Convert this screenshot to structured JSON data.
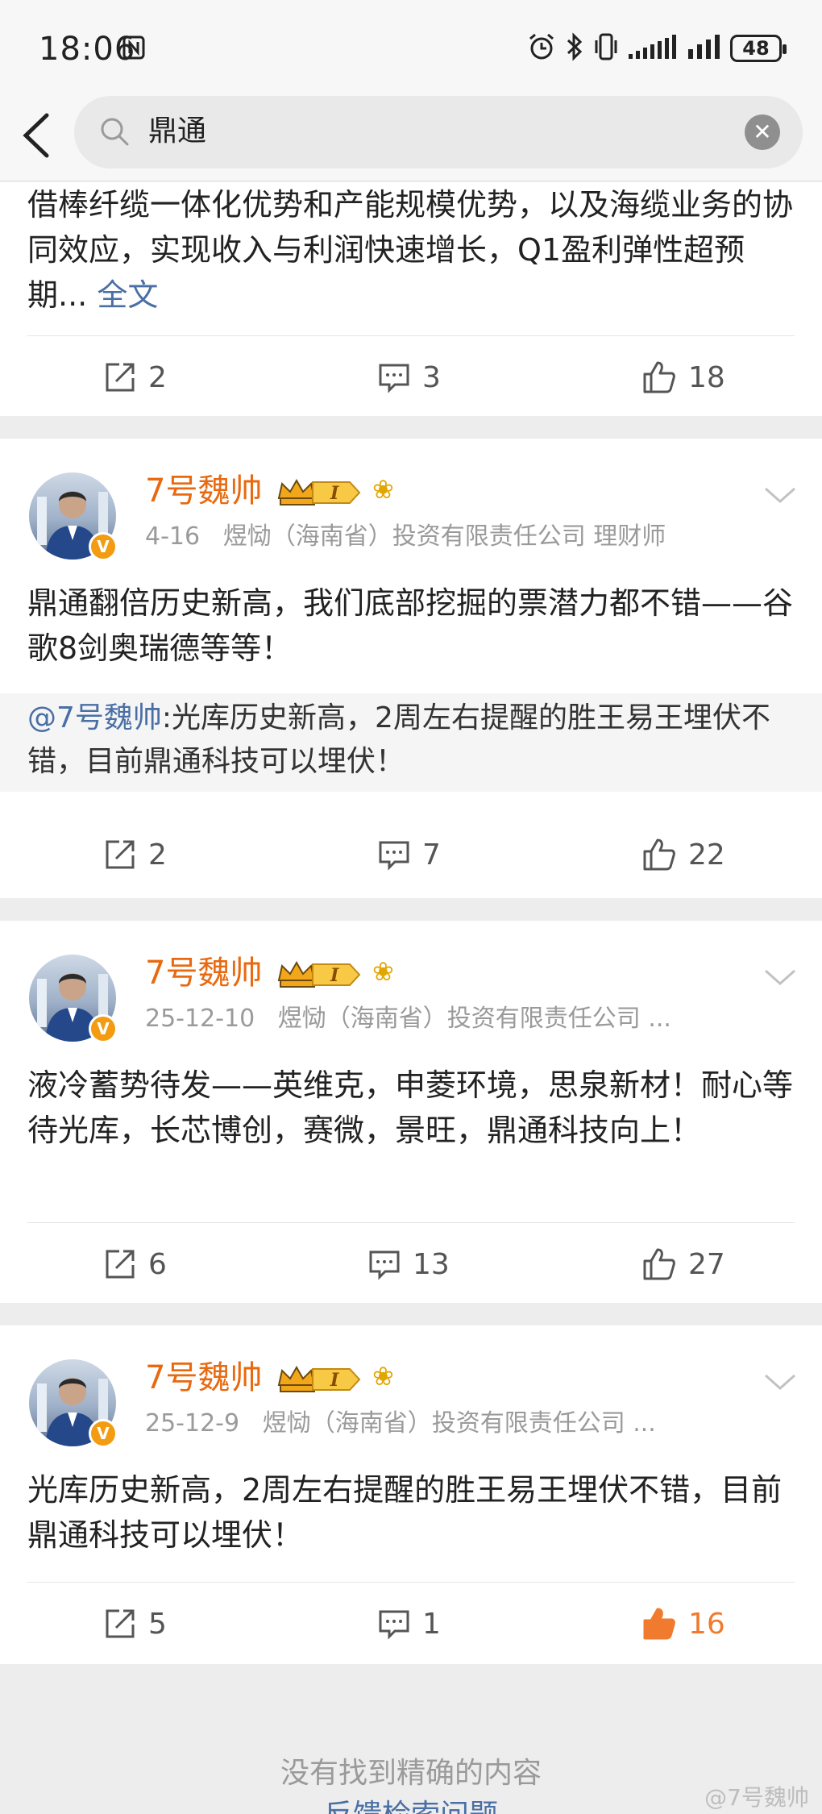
{
  "status_bar": {
    "time": "18:06",
    "icons": [
      "nfc-icon",
      "alarm-icon",
      "bluetooth-icon",
      "vibrate-icon",
      "signal-icon",
      "signal-icon"
    ],
    "battery": "48"
  },
  "search": {
    "query": "鼎通"
  },
  "posts": [
    {
      "text": "借棒纤缆一体化优势和产能规模优势，以及海缆业务的协同效应，实现收入与利润快速增长，Q1盈利弹性超预期...",
      "more_label": "全文",
      "reposts": "2",
      "comments": "3",
      "likes": "18"
    },
    {
      "username": "7号魏帅",
      "date": "4-16",
      "source": "煜恸（海南省）投资有限责任公司 理财师",
      "text": "鼎通翻倍历史新高，我们底部挖掘的票潜力都不错——谷歌8剑奥瑞德等等！",
      "quote_mention": "@7号魏帅",
      "quote_text": ":光库历史新高，2周左右提醒的胜王易王埋伏不错，目前鼎通科技可以埋伏！",
      "reposts": "2",
      "comments": "7",
      "likes": "22"
    },
    {
      "username": "7号魏帅",
      "date": "25-12-10",
      "source": "煜恸（海南省）投资有限责任公司 ...",
      "text": "液冷蓄势待发——英维克，申菱环境，思泉新材！耐心等待光库，长芯博创，赛微，景旺，鼎通科技向上！",
      "reposts": "6",
      "comments": "13",
      "likes": "27"
    },
    {
      "username": "7号魏帅",
      "date": "25-12-9",
      "source": "煜恸（海南省）投资有限责任公司 ...",
      "text": "光库历史新高，2周左右提醒的胜王易王埋伏不错，目前鼎通科技可以埋伏！",
      "reposts": "5",
      "comments": "1",
      "likes": "16"
    }
  ],
  "badge": {
    "level": "I",
    "vip_mark": "V"
  },
  "footer": {
    "note": "没有找到精确的内容",
    "link": "反馈检索问题"
  },
  "watermark": "@7号魏帅",
  "colors": {
    "username": "#e8690f",
    "link": "#4a6fa5",
    "liked": "#f07b2e",
    "background": "#ededed"
  }
}
